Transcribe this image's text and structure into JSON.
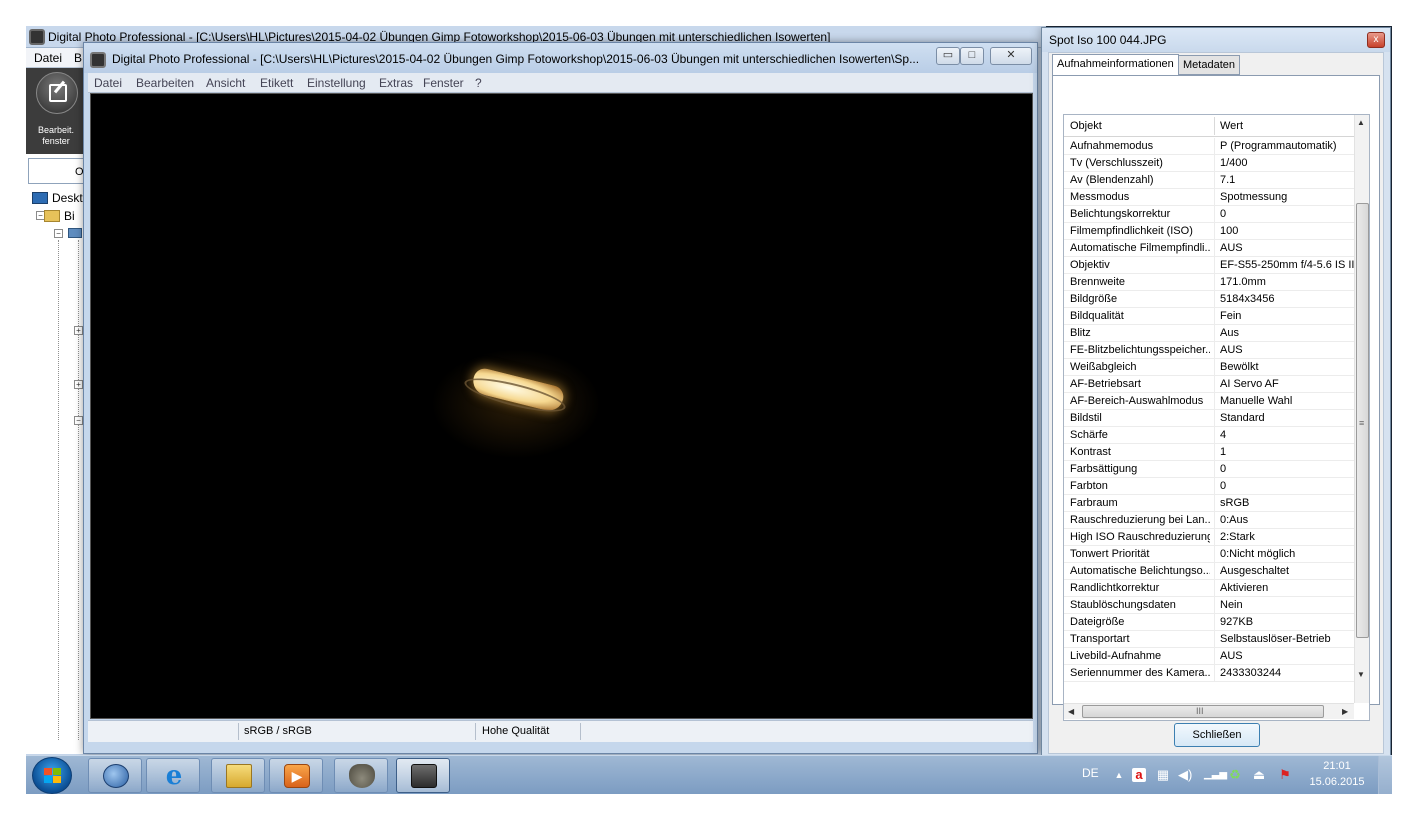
{
  "main_window": {
    "title": "Digital Photo Professional - [C:\\Users\\HL\\Pictures\\2015-04-02 Übungen  Gimp Fotoworkshop\\2015-06-03 Übungen mit unterschiedlichen Isowerten]",
    "menu_datei": "Datei",
    "menu_b": "B",
    "edit_button_label": "Bearbeit. fenster",
    "left_tab_label": "O",
    "tree_desktop": "Deskt",
    "tree_node2": "Bi"
  },
  "child_window": {
    "title": "Digital Photo Professional - [C:\\Users\\HL\\Pictures\\2015-04-02 Übungen  Gimp Fotoworkshop\\2015-06-03 Übungen mit unterschiedlichen Isowerten\\Sp...",
    "menu": [
      "Datei",
      "Bearbeiten",
      "Ansicht",
      "Etikett",
      "Einstellung",
      "Extras",
      "Fenster",
      "?"
    ],
    "status_color": "sRGB / sRGB",
    "status_quality": "Hohe Qualität",
    "min_glyph": "▭",
    "max_glyph": "□",
    "close_glyph": "✕"
  },
  "info_dialog": {
    "title": "Spot Iso 100  044.JPG",
    "tabs": [
      "Aufnahmeinformationen",
      "Metadaten"
    ],
    "col_object": "Objekt",
    "col_value": "Wert",
    "close_button": "Schließen",
    "close_glyph": "x",
    "scroll_grip_v": "≡",
    "scroll_grip_h": "III",
    "rows": [
      {
        "key": "Aufnahmemodus",
        "value": "P (Programmautomatik)"
      },
      {
        "key": "Tv (Verschlusszeit)",
        "value": "1/400"
      },
      {
        "key": "Av (Blendenzahl)",
        "value": "7.1"
      },
      {
        "key": "Messmodus",
        "value": "Spotmessung"
      },
      {
        "key": "Belichtungskorrektur",
        "value": "0"
      },
      {
        "key": "Filmempfindlichkeit (ISO)",
        "value": "100"
      },
      {
        "key": "Automatische Filmempfindli...",
        "value": "AUS"
      },
      {
        "key": "Objektiv",
        "value": "EF-S55-250mm f/4-5.6 IS II"
      },
      {
        "key": "Brennweite",
        "value": "171.0mm"
      },
      {
        "key": "Bildgröße",
        "value": "5184x3456"
      },
      {
        "key": "Bildqualität",
        "value": "Fein"
      },
      {
        "key": "Blitz",
        "value": "Aus"
      },
      {
        "key": "FE-Blitzbelichtungsspeicher...",
        "value": "AUS"
      },
      {
        "key": "Weißabgleich",
        "value": "Bewölkt"
      },
      {
        "key": "AF-Betriebsart",
        "value": "AI Servo AF"
      },
      {
        "key": "AF-Bereich-Auswahlmodus",
        "value": "Manuelle  Wahl"
      },
      {
        "key": "Bildstil",
        "value": "Standard"
      },
      {
        "key": "Schärfe",
        "value": "4"
      },
      {
        "key": "Kontrast",
        "value": "1"
      },
      {
        "key": "Farbsättigung",
        "value": "0"
      },
      {
        "key": "Farbton",
        "value": "0"
      },
      {
        "key": "Farbraum",
        "value": "sRGB"
      },
      {
        "key": "Rauschreduzierung bei Lan...",
        "value": "0:Aus"
      },
      {
        "key": "High ISO Rauschreduzierung",
        "value": "2:Stark"
      },
      {
        "key": "Tonwert Priorität",
        "value": "0:Nicht möglich"
      },
      {
        "key": "Automatische Belichtungso...",
        "value": "Ausgeschaltet"
      },
      {
        "key": "Randlichtkorrektur",
        "value": "Aktivieren"
      },
      {
        "key": "Staublöschungsdaten",
        "value": "Nein"
      },
      {
        "key": "Dateigröße",
        "value": "927KB"
      },
      {
        "key": "Transportart",
        "value": "Selbstauslöser-Betrieb"
      },
      {
        "key": "Livebild-Aufnahme",
        "value": "AUS"
      },
      {
        "key": "Seriennummer des Kamera...",
        "value": "2433303244"
      }
    ]
  },
  "taskbar": {
    "apps": [
      "thunderbird-icon",
      "internet-explorer-icon",
      "explorer-icon",
      "media-player-icon",
      "gimp-icon",
      "dpp-icon"
    ],
    "language": "DE",
    "time": "21:01",
    "date": "15.06.2015"
  }
}
